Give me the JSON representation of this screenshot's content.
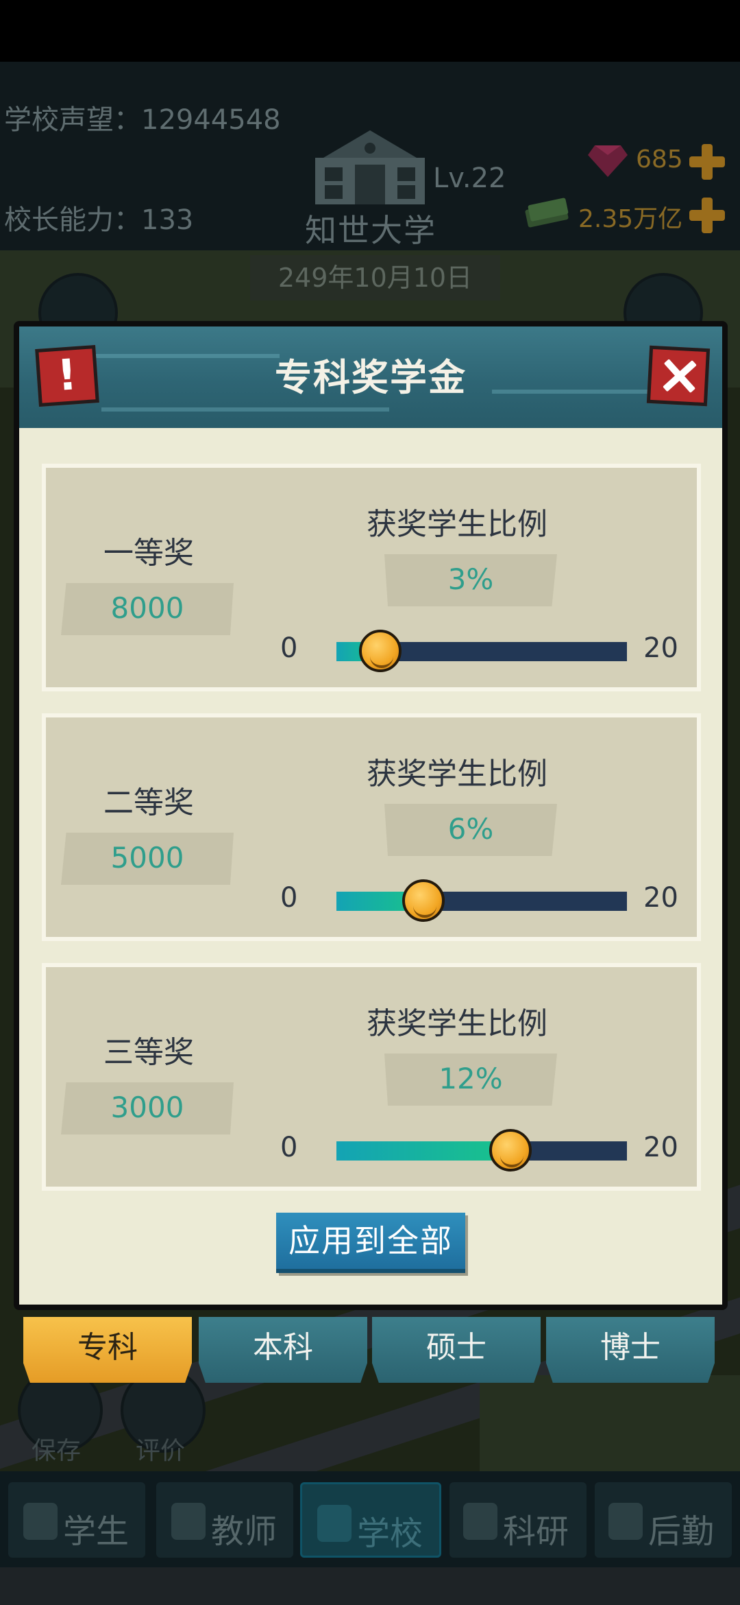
{
  "header": {
    "reputation_label": "学校声望：",
    "reputation_value": "12944548",
    "ability_label": "校长能力：",
    "ability_value": "133",
    "level": "Lv.22",
    "school_name": "知世大学",
    "gems": "685",
    "money": "2.35万亿",
    "date": "249年10月10日"
  },
  "modal": {
    "title": "专科奖学金",
    "alert_icon": "!",
    "ratio_label": "获奖学生比例",
    "slider_min": "0",
    "slider_max": "20",
    "slider_range": [
      0,
      20
    ],
    "prizes": [
      {
        "name": "一等奖",
        "amount": "8000",
        "percent_text": "3%",
        "value": 3
      },
      {
        "name": "二等奖",
        "amount": "5000",
        "percent_text": "6%",
        "value": 6
      },
      {
        "name": "三等奖",
        "amount": "3000",
        "percent_text": "12%",
        "value": 12
      }
    ],
    "apply_button": "应用到全部"
  },
  "degree_tabs": [
    {
      "label": "专科",
      "active": true
    },
    {
      "label": "本科",
      "active": false
    },
    {
      "label": "硕士",
      "active": false
    },
    {
      "label": "博士",
      "active": false
    }
  ],
  "background_actions": {
    "save": "保存",
    "review": "评价"
  },
  "bottom_nav": [
    {
      "label": "学生",
      "icon": "student-icon",
      "active": false
    },
    {
      "label": "教师",
      "icon": "teacher-icon",
      "active": false
    },
    {
      "label": "学校",
      "icon": "school-icon",
      "active": true
    },
    {
      "label": "科研",
      "icon": "flask-icon",
      "active": false
    },
    {
      "label": "后勤",
      "icon": "clipboard-icon",
      "active": false
    }
  ],
  "colors": {
    "accent_teal": "#2f9e8c",
    "tab_active": "#f2ad35",
    "header_blue": "#2e6574",
    "close_red": "#b72a2a"
  }
}
